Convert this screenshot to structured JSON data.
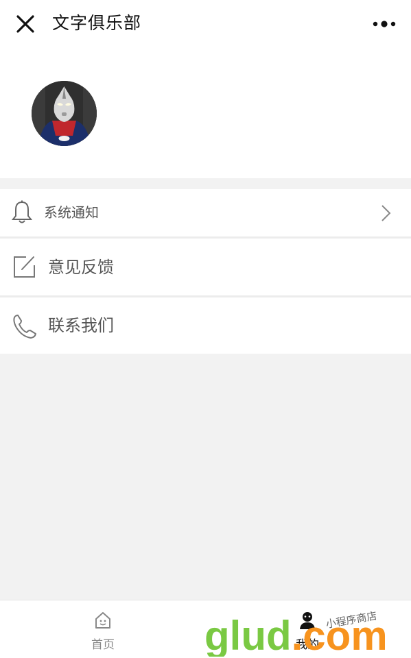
{
  "nav": {
    "title": "文字俱乐部",
    "close_icon": "close-icon",
    "more_icon": "more-dots-icon"
  },
  "profile": {
    "avatar_icon": "user-avatar"
  },
  "menu": {
    "items": [
      {
        "label": "系统通知",
        "icon": "bell-icon",
        "has_chevron": true
      },
      {
        "label": "意见反馈",
        "icon": "edit-icon",
        "has_chevron": false
      },
      {
        "label": "联系我们",
        "icon": "phone-icon",
        "has_chevron": false
      }
    ]
  },
  "tabbar": {
    "tabs": [
      {
        "label": "首页",
        "icon": "home-icon",
        "active": false
      },
      {
        "label": "我的",
        "icon": "person-icon",
        "active": true
      }
    ]
  },
  "watermark": {
    "brand": "glud.com",
    "tagline": "小程序商店"
  },
  "colors": {
    "page_bg": "#f2f2f2",
    "surface": "#ffffff",
    "text_primary": "#111111",
    "text_secondary": "#555555",
    "watermark_green": "#7ac943",
    "watermark_orange": "#f7931e"
  }
}
